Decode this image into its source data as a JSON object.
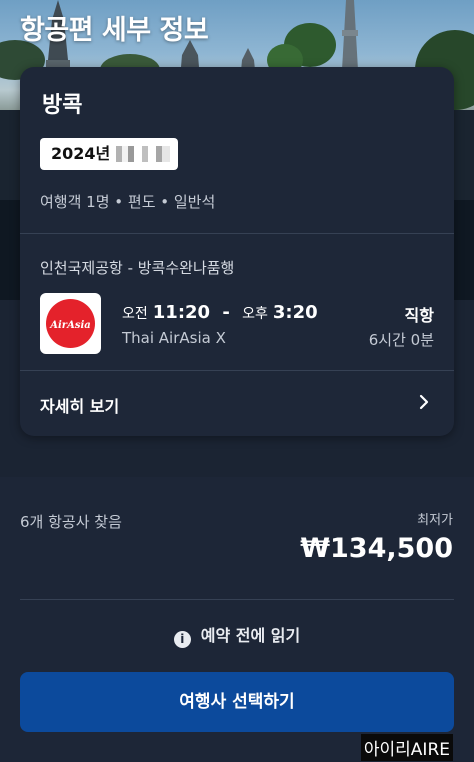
{
  "header": {
    "title": "항공편 세부 정보"
  },
  "card": {
    "city": "방콕",
    "date_prefix": "2024년",
    "trip_summary": "여행객 1명 • 편도 • 일반석",
    "route": "인천국제공항 - 방콕수완나품행",
    "airline_logo_text": "AirAsia",
    "depart_period": "오전",
    "depart_time": "11:20",
    "time_separator": "-",
    "arrive_period": "오후",
    "arrive_time": "3:20",
    "airline": "Thai AirAsia X",
    "stops": "직항",
    "duration": "6시간 0분",
    "details_link": "자세히 보기"
  },
  "results": {
    "airlines_found": "6개 항공사 찾음",
    "lowest_label": "최저가",
    "lowest_price": "₩134,500"
  },
  "notice": {
    "label": "예약 전에 읽기"
  },
  "cta": {
    "label": "여행사 선택하기"
  },
  "watermark": "아이리AIRE",
  "colors": {
    "accent_button": "#0c4a9c",
    "card_bg": "#1e2738",
    "page_bg": "#1b2433",
    "logo_red": "#e4222b"
  },
  "icons": {
    "info": "info-circle-icon",
    "details": "chevron-right-icon"
  }
}
